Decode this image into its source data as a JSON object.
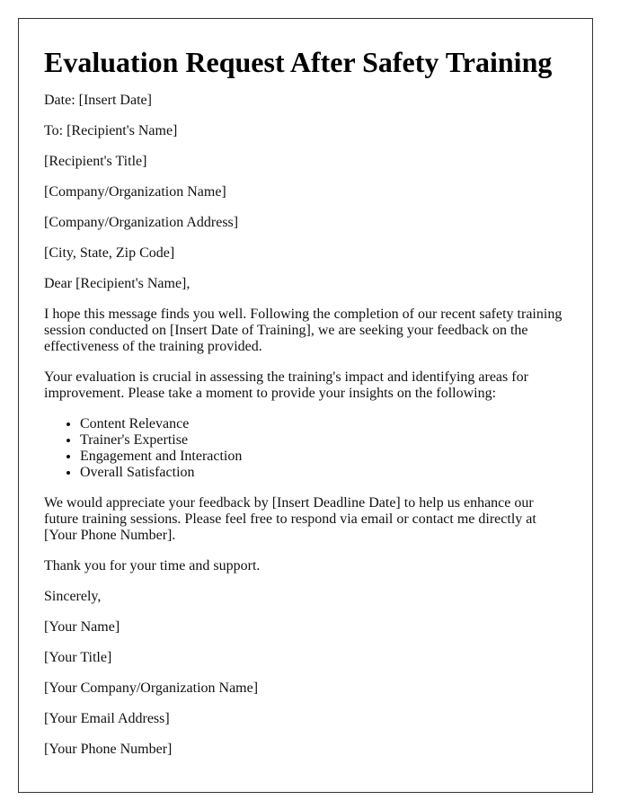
{
  "document": {
    "title": "Evaluation Request After Safety Training",
    "header_lines": [
      "Date: [Insert Date]",
      "To: [Recipient's Name]",
      "[Recipient's Title]",
      "[Company/Organization Name]",
      "[Company/Organization Address]",
      "[City, State, Zip Code]"
    ],
    "salutation": "Dear [Recipient's Name],",
    "paragraphs": [
      "I hope this message finds you well. Following the completion of our recent safety training session conducted on [Insert Date of Training], we are seeking your feedback on the effectiveness of the training provided.",
      "Your evaluation is crucial in assessing the training's impact and identifying areas for improvement. Please take a moment to provide your insights on the following:"
    ],
    "feedback_items": [
      "Content Relevance",
      "Trainer's Expertise",
      "Engagement and Interaction",
      "Overall Satisfaction"
    ],
    "closing_paragraphs": [
      "We would appreciate your feedback by [Insert Deadline Date] to help us enhance our future training sessions. Please feel free to respond via email or contact me directly at [Your Phone Number].",
      "Thank you for your time and support."
    ],
    "sign_off": "Sincerely,",
    "signature_lines": [
      "[Your Name]",
      "[Your Title]",
      "[Your Company/Organization Name]",
      "[Your Email Address]",
      "[Your Phone Number]"
    ]
  }
}
